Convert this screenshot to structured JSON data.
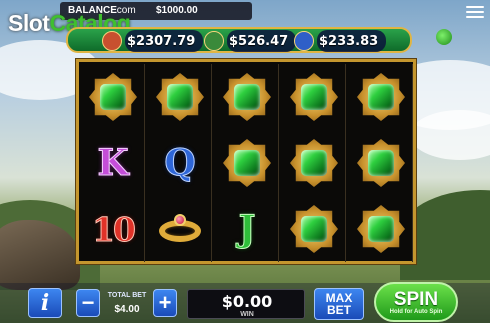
{
  "header": {
    "balance_label": "BALANCE",
    "site_suffix": ".com",
    "balance_value": "$1000.00",
    "logo_part1": "Slot",
    "logo_part2": "Catalog"
  },
  "jackpots": [
    {
      "amount": "$2307.79",
      "face_color": "#c8502f"
    },
    {
      "amount": "$526.47",
      "face_color": "#3a8a3a"
    },
    {
      "amount": "$233.83",
      "face_color": "#2f5fc8"
    }
  ],
  "reels": [
    [
      "emerald",
      "K",
      "10"
    ],
    [
      "emerald",
      "Q",
      "ring"
    ],
    [
      "emerald",
      "emerald",
      "J"
    ],
    [
      "emerald",
      "emerald",
      "emerald"
    ],
    [
      "emerald",
      "emerald",
      "emerald"
    ]
  ],
  "controls": {
    "info_label": "i",
    "minus_label": "−",
    "plus_label": "+",
    "total_bet_label": "TOTAL BET",
    "total_bet_value": "$4.00",
    "win_value": "$0.00",
    "win_label": "WIN",
    "maxbet_line1": "MAX",
    "maxbet_line2": "BET",
    "spin_label": "SPIN",
    "spin_sub": "Hold for Auto Spin"
  },
  "colors": {
    "accent_gold": "#c4962e",
    "spin_green": "#2fbf3a",
    "button_blue": "#1a4bb8"
  }
}
